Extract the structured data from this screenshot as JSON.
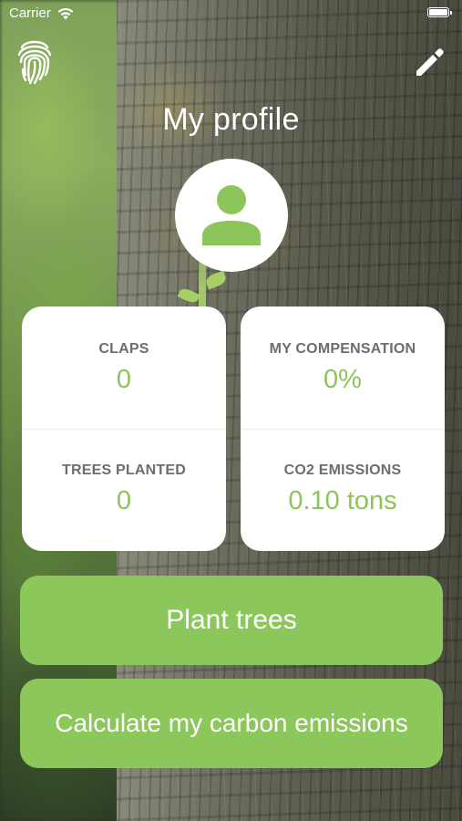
{
  "status_bar": {
    "carrier": "Carrier"
  },
  "header": {
    "title": "My profile",
    "left_icon": "fingerprint-icon",
    "right_icon": "pencil-icon"
  },
  "avatar": {
    "icon": "user-icon"
  },
  "stats": {
    "claps": {
      "label": "CLAPS",
      "value": "0"
    },
    "compensation": {
      "label": "MY COMPENSATION",
      "value": "0%"
    },
    "trees_planted": {
      "label": "TREES PLANTED",
      "value": "0"
    },
    "co2_emissions": {
      "label": "CO2 EMISSIONS",
      "value": "0.10 tons"
    }
  },
  "actions": {
    "plant_trees": "Plant trees",
    "calculate_emissions": "Calculate my carbon emissions"
  },
  "colors": {
    "accent": "#8cc75c",
    "value_text": "#8cc55a",
    "label_text": "#6d6d6d",
    "card_bg": "#ffffff"
  }
}
